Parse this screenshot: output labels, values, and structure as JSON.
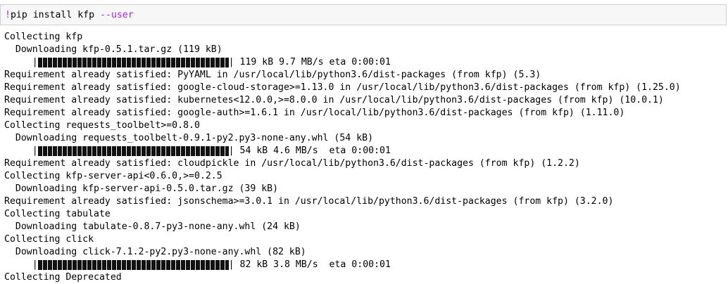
{
  "input_cell": {
    "bang": "!",
    "command": "pip install kfp ",
    "flag": "--user"
  },
  "output_lines": [
    {
      "type": "text",
      "text": "Collecting kfp"
    },
    {
      "type": "text",
      "text": "  Downloading kfp-0.5.1.tar.gz (119 kB)"
    },
    {
      "type": "progress",
      "prefix": "     |",
      "suffix": "| 119 kB 9.7 MB/s eta 0:00:01",
      "percent": 100
    },
    {
      "type": "text",
      "text": "Requirement already satisfied: PyYAML in /usr/local/lib/python3.6/dist-packages (from kfp) (5.3)"
    },
    {
      "type": "text",
      "text": "Requirement already satisfied: google-cloud-storage>=1.13.0 in /usr/local/lib/python3.6/dist-packages (from kfp) (1.25.0)"
    },
    {
      "type": "text",
      "text": "Requirement already satisfied: kubernetes<12.0.0,>=8.0.0 in /usr/local/lib/python3.6/dist-packages (from kfp) (10.0.1)"
    },
    {
      "type": "text",
      "text": "Requirement already satisfied: google-auth>=1.6.1 in /usr/local/lib/python3.6/dist-packages (from kfp) (1.11.0)"
    },
    {
      "type": "text",
      "text": "Collecting requests_toolbelt>=0.8.0"
    },
    {
      "type": "text",
      "text": "  Downloading requests_toolbelt-0.9.1-py2.py3-none-any.whl (54 kB)"
    },
    {
      "type": "progress",
      "prefix": "     |",
      "suffix": "| 54 kB 4.6 MB/s  eta 0:00:01",
      "percent": 100
    },
    {
      "type": "text",
      "text": "Requirement already satisfied: cloudpickle in /usr/local/lib/python3.6/dist-packages (from kfp) (1.2.2)"
    },
    {
      "type": "text",
      "text": "Collecting kfp-server-api<0.6.0,>=0.2.5"
    },
    {
      "type": "text",
      "text": "  Downloading kfp-server-api-0.5.0.tar.gz (39 kB)"
    },
    {
      "type": "text",
      "text": "Requirement already satisfied: jsonschema>=3.0.1 in /usr/local/lib/python3.6/dist-packages (from kfp) (3.2.0)"
    },
    {
      "type": "text",
      "text": "Collecting tabulate"
    },
    {
      "type": "text",
      "text": "  Downloading tabulate-0.8.7-py3-none-any.whl (24 kB)"
    },
    {
      "type": "text",
      "text": "Collecting click"
    },
    {
      "type": "text",
      "text": "  Downloading click-7.1.2-py2.py3-none-any.whl (82 kB)"
    },
    {
      "type": "progress",
      "prefix": "     |",
      "suffix": "| 82 kB 3.8 MB/s  eta 0:00:01",
      "percent": 100
    },
    {
      "type": "text",
      "text": "Collecting Deprecated"
    }
  ]
}
